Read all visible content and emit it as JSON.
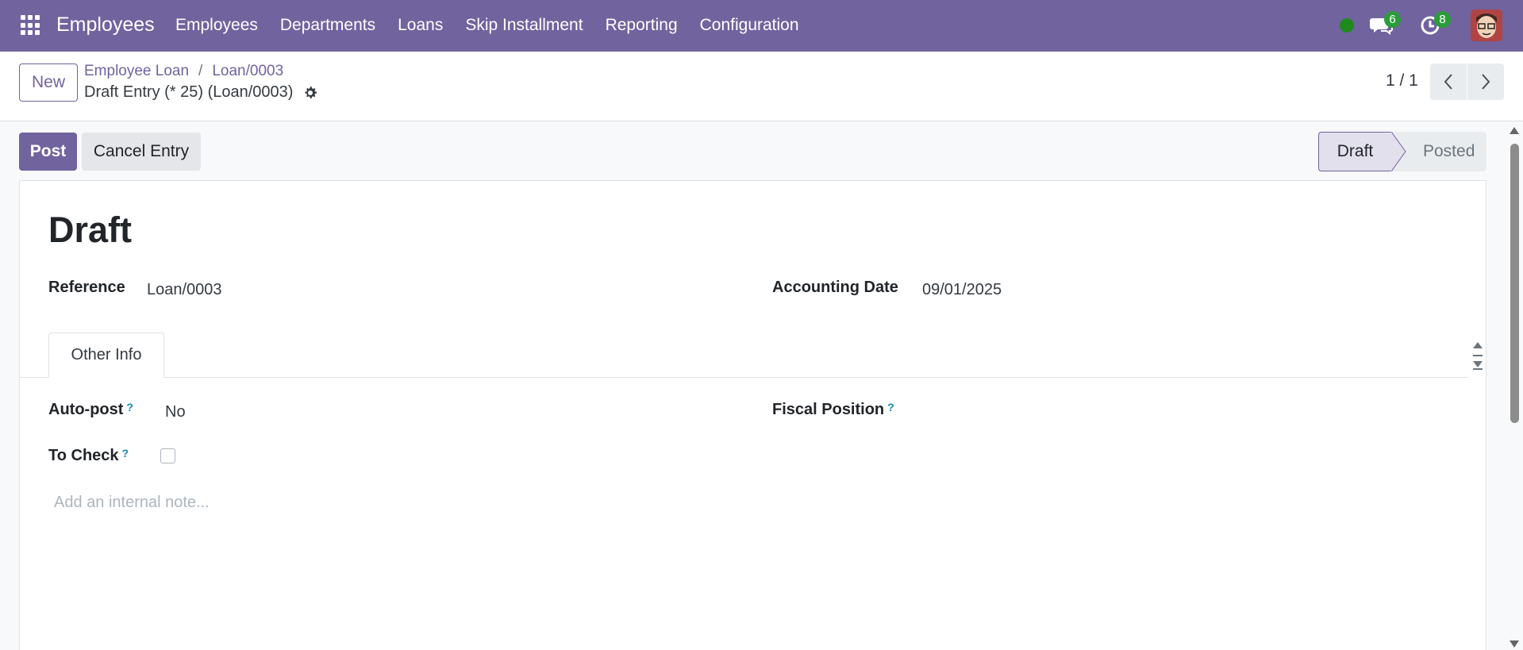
{
  "navbar": {
    "app_title": "Employees",
    "menu": [
      "Employees",
      "Departments",
      "Loans",
      "Skip Installment",
      "Reporting",
      "Configuration"
    ],
    "chat_count": "6",
    "activity_count": "8",
    "bg_color": "#71639e"
  },
  "control_panel": {
    "new_label": "New",
    "breadcrumb": [
      "Employee Loan",
      "Loan/0003"
    ],
    "record_name": "Draft Entry (* 25) (Loan/0003)",
    "pager": "1 / 1"
  },
  "actions": {
    "post_label": "Post",
    "cancel_label": "Cancel Entry"
  },
  "statusbar": {
    "stages": [
      "Draft",
      "Posted"
    ],
    "active": "Draft"
  },
  "form": {
    "title": "Draft",
    "reference_label": "Reference",
    "reference_value": "Loan/0003",
    "accounting_date_label": "Accounting Date",
    "accounting_date_value": "09/01/2025",
    "tab_label": "Other Info",
    "auto_post_label": "Auto-post",
    "auto_post_value": "No",
    "fiscal_position_label": "Fiscal Position",
    "to_check_label": "To Check",
    "to_check_checked": false,
    "help_mark": "?",
    "note_placeholder": "Add an internal note..."
  }
}
